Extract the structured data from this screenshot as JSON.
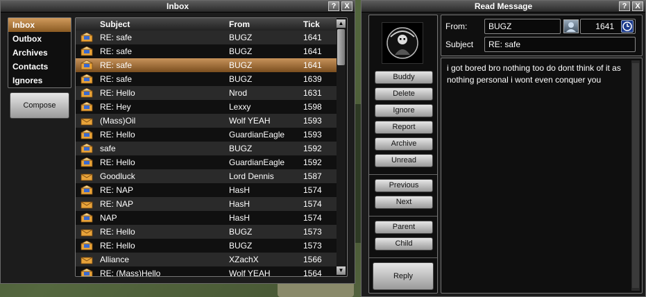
{
  "inbox": {
    "title": "Inbox",
    "help_label": "?",
    "close_label": "X",
    "folders": [
      {
        "label": "Inbox",
        "active": true
      },
      {
        "label": "Outbox"
      },
      {
        "label": "Archives"
      },
      {
        "label": "Contacts"
      },
      {
        "label": "Ignores"
      }
    ],
    "compose_label": "Compose",
    "columns": {
      "subject": "Subject",
      "from": "From",
      "tick": "Tick"
    },
    "messages": [
      {
        "subject": "RE: safe",
        "from": "BUGZ",
        "tick": "1641",
        "icon": "envelope-open-icon"
      },
      {
        "subject": "RE: safe",
        "from": "BUGZ",
        "tick": "1641",
        "icon": "envelope-open-icon"
      },
      {
        "subject": "RE: safe",
        "from": "BUGZ",
        "tick": "1641",
        "icon": "envelope-open-icon",
        "selected": true
      },
      {
        "subject": "RE: safe",
        "from": "BUGZ",
        "tick": "1639",
        "icon": "envelope-open-icon"
      },
      {
        "subject": "RE: Hello",
        "from": "Nrod",
        "tick": "1631",
        "icon": "envelope-open-icon"
      },
      {
        "subject": "RE: Hey",
        "from": "Lexxy",
        "tick": "1598",
        "icon": "envelope-open-icon"
      },
      {
        "subject": "(Mass)Oil",
        "from": "Wolf YEAH",
        "tick": "1593",
        "icon": "envelope-icon"
      },
      {
        "subject": "RE: Hello",
        "from": "GuardianEagle",
        "tick": "1593",
        "icon": "envelope-open-icon"
      },
      {
        "subject": "safe",
        "from": "BUGZ",
        "tick": "1592",
        "icon": "envelope-open-icon"
      },
      {
        "subject": "RE: Hello",
        "from": "GuardianEagle",
        "tick": "1592",
        "icon": "envelope-open-icon"
      },
      {
        "subject": "Goodluck",
        "from": "Lord Dennis",
        "tick": "1587",
        "icon": "envelope-icon"
      },
      {
        "subject": "RE: NAP",
        "from": "HasH",
        "tick": "1574",
        "icon": "envelope-open-icon"
      },
      {
        "subject": "RE: NAP",
        "from": "HasH",
        "tick": "1574",
        "icon": "envelope-icon"
      },
      {
        "subject": "NAP",
        "from": "HasH",
        "tick": "1574",
        "icon": "envelope-open-icon"
      },
      {
        "subject": "RE: Hello",
        "from": "BUGZ",
        "tick": "1573",
        "icon": "envelope-icon"
      },
      {
        "subject": "RE: Hello",
        "from": "BUGZ",
        "tick": "1573",
        "icon": "envelope-open-icon"
      },
      {
        "subject": "Alliance",
        "from": "XZachX",
        "tick": "1566",
        "icon": "envelope-icon"
      },
      {
        "subject": "RE: (Mass)Hello",
        "from": "Wolf YEAH",
        "tick": "1564",
        "icon": "envelope-open-icon"
      }
    ]
  },
  "read": {
    "title": "Read Message",
    "help_label": "?",
    "close_label": "X",
    "actions": [
      "Buddy",
      "Delete",
      "Ignore",
      "Report",
      "Archive",
      "Unread"
    ],
    "nav": [
      "Previous",
      "Next"
    ],
    "thread": [
      "Parent",
      "Child"
    ],
    "reply_label": "Reply",
    "from_label": "From:",
    "from_value": "BUGZ",
    "tick_value": "1641",
    "subject_label": "Subject",
    "subject_value": "RE: safe",
    "body": "i got bored bro nothing too do dont think of it as nothing personal i wont even conquer you"
  },
  "colors": {
    "selected_row": "#b8864e",
    "window_bg": "#1c1c1c",
    "accent_blue": "#1b3a8c"
  }
}
